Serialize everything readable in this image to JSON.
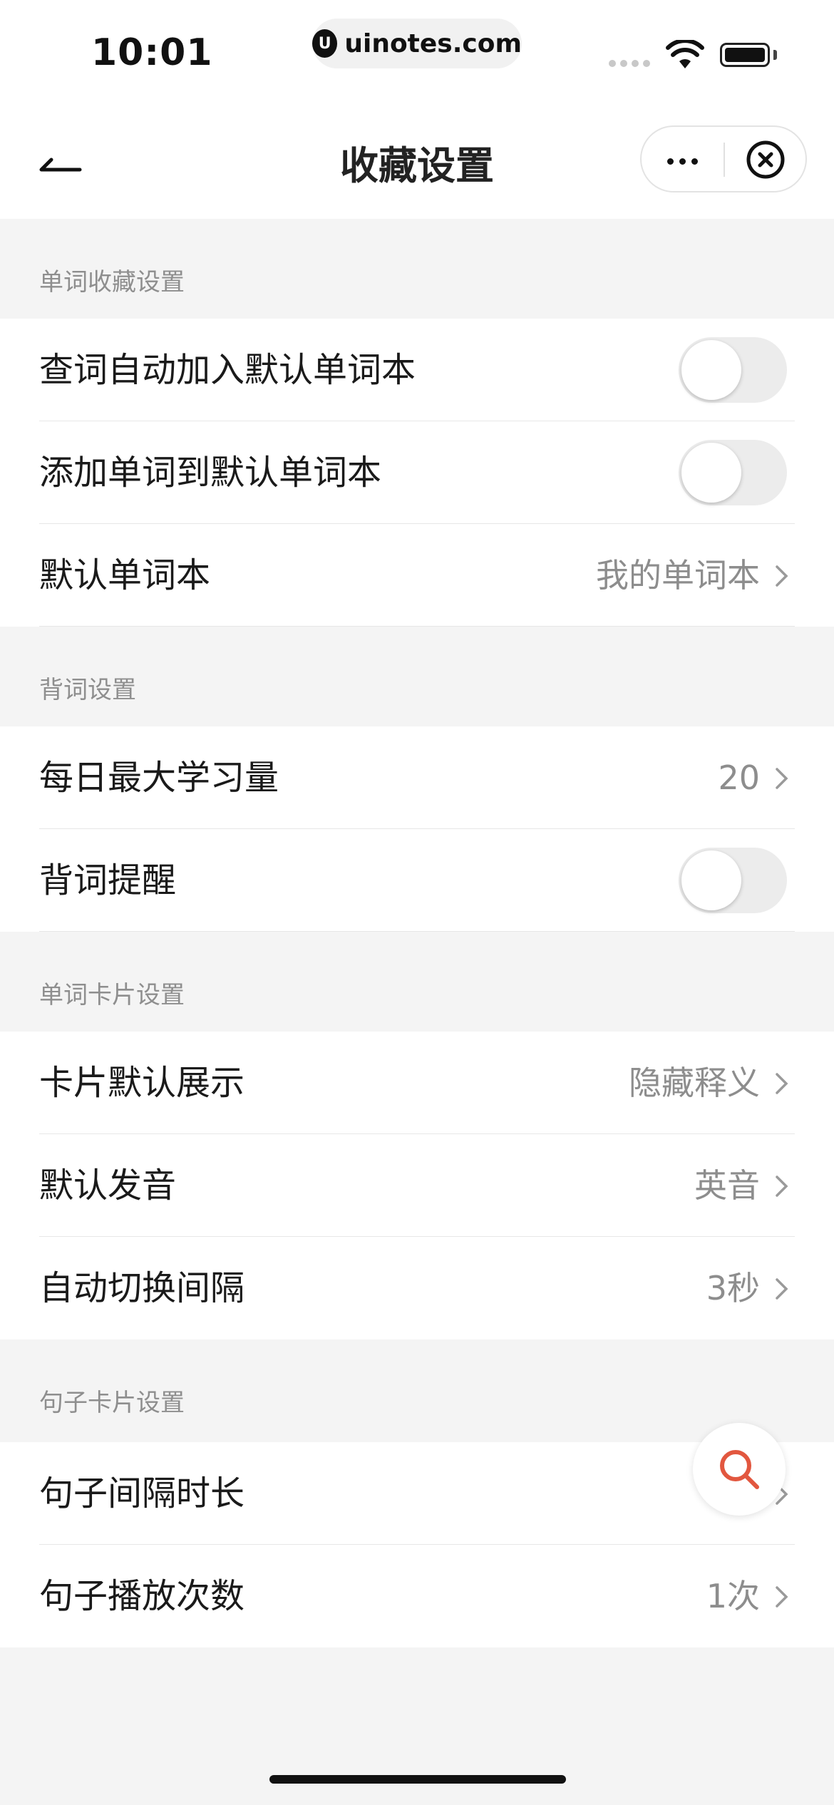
{
  "status_bar": {
    "time": "10:01",
    "url": "uinotes.com",
    "url_logo_letter": "U"
  },
  "nav": {
    "title": "收藏设置"
  },
  "sections": [
    {
      "title": "单词收藏设置",
      "rows": [
        {
          "label": "查词自动加入默认单词本",
          "type": "toggle",
          "on": false
        },
        {
          "label": "添加单词到默认单词本",
          "type": "toggle",
          "on": false
        },
        {
          "label": "默认单词本",
          "type": "link",
          "value": "我的单词本"
        }
      ]
    },
    {
      "title": "背词设置",
      "rows": [
        {
          "label": "每日最大学习量",
          "type": "link",
          "value": "20"
        },
        {
          "label": "背词提醒",
          "type": "toggle",
          "on": false
        }
      ]
    },
    {
      "title": "单词卡片设置",
      "rows": [
        {
          "label": "卡片默认展示",
          "type": "link",
          "value": "隐藏释义"
        },
        {
          "label": "默认发音",
          "type": "link",
          "value": "英音"
        },
        {
          "label": "自动切换间隔",
          "type": "link",
          "value": "3秒"
        }
      ]
    },
    {
      "title": "句子卡片设置",
      "rows": [
        {
          "label": "句子间隔时长",
          "type": "link",
          "value": ""
        },
        {
          "label": "句子播放次数",
          "type": "link",
          "value": "1次"
        }
      ]
    }
  ],
  "colors": {
    "accent": "#e2573f",
    "background": "#f4f4f4",
    "toggle_off": "#ececec"
  },
  "icons": {
    "back": "back-arrow-icon",
    "more": "more-dots-icon",
    "close": "close-circle-icon",
    "fab": "search-icon"
  }
}
